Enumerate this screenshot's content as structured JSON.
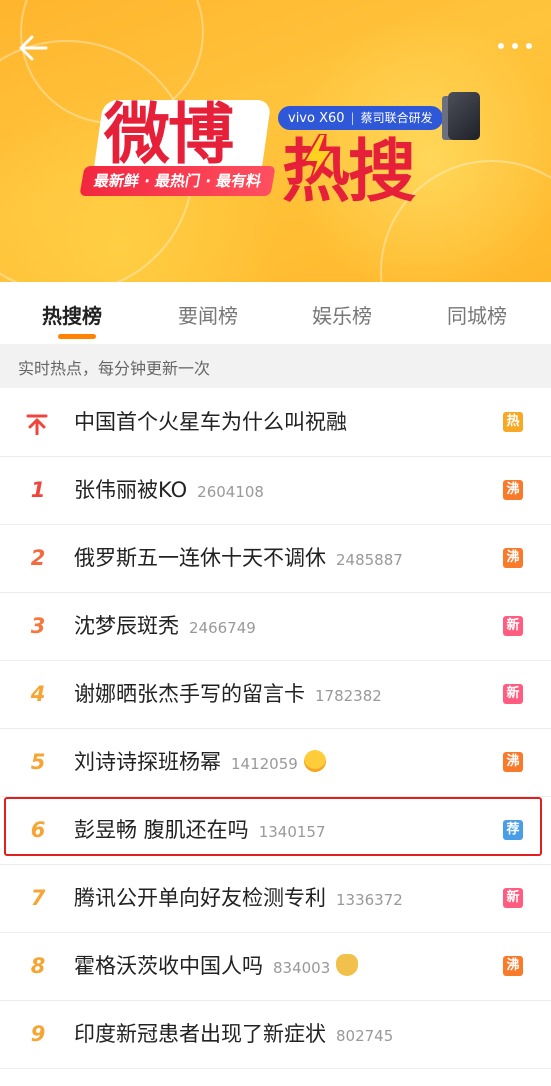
{
  "banner": {
    "brand_title_1": "微博",
    "brand_title_2": "热搜",
    "slogan": "最新鲜 · 最热门 · 最有料",
    "sponsor_brand": "vivo X60",
    "sponsor_tag": "蔡司联合研发",
    "back_icon": "back-arrow-icon",
    "more_icon": "more-dots-icon"
  },
  "tabs": [
    {
      "label": "热搜榜",
      "active": true
    },
    {
      "label": "要闻榜",
      "active": false
    },
    {
      "label": "娱乐榜",
      "active": false
    },
    {
      "label": "同城榜",
      "active": false
    }
  ],
  "subheader": "实时热点，每分钟更新一次",
  "items": [
    {
      "rank": "",
      "pinned": true,
      "title": "中国首个火星车为什么叫祝融",
      "count": "",
      "badge": "热",
      "badge_type": "hot"
    },
    {
      "rank": "1",
      "title": "张伟丽被KO",
      "count": "2604108",
      "badge": "沸",
      "badge_type": "boil"
    },
    {
      "rank": "2",
      "title": "俄罗斯五一连休十天不调休",
      "count": "2485887",
      "badge": "沸",
      "badge_type": "boil"
    },
    {
      "rank": "3",
      "title": "沈梦辰斑秃",
      "count": "2466749",
      "badge": "新",
      "badge_type": "new"
    },
    {
      "rank": "4",
      "title": "谢娜晒张杰手写的留言卡",
      "count": "1782382",
      "badge": "新",
      "badge_type": "new"
    },
    {
      "rank": "5",
      "title": "刘诗诗探班杨幂",
      "count": "1412059",
      "emoji": "crying-face-icon",
      "badge": "沸",
      "badge_type": "boil"
    },
    {
      "rank": "6",
      "title": "彭昱畅 腹肌还在吗",
      "count": "1340157",
      "badge": "荐",
      "badge_type": "rec",
      "highlighted": true
    },
    {
      "rank": "7",
      "title": "腾讯公开单向好友检测专利",
      "count": "1336372",
      "badge": "新",
      "badge_type": "new"
    },
    {
      "rank": "8",
      "title": "霍格沃茨收中国人吗",
      "count": "834003",
      "emoji": "doge-icon",
      "badge": "沸",
      "badge_type": "boil"
    },
    {
      "rank": "9",
      "title": "印度新冠患者出现了新症状",
      "count": "802745",
      "badge": "",
      "badge_type": ""
    }
  ],
  "colors": {
    "banner_orange": "#ffb52e",
    "accent_red": "#e7203a",
    "tab_underline": "#ff8200",
    "highlight_border": "#e21f1f"
  }
}
